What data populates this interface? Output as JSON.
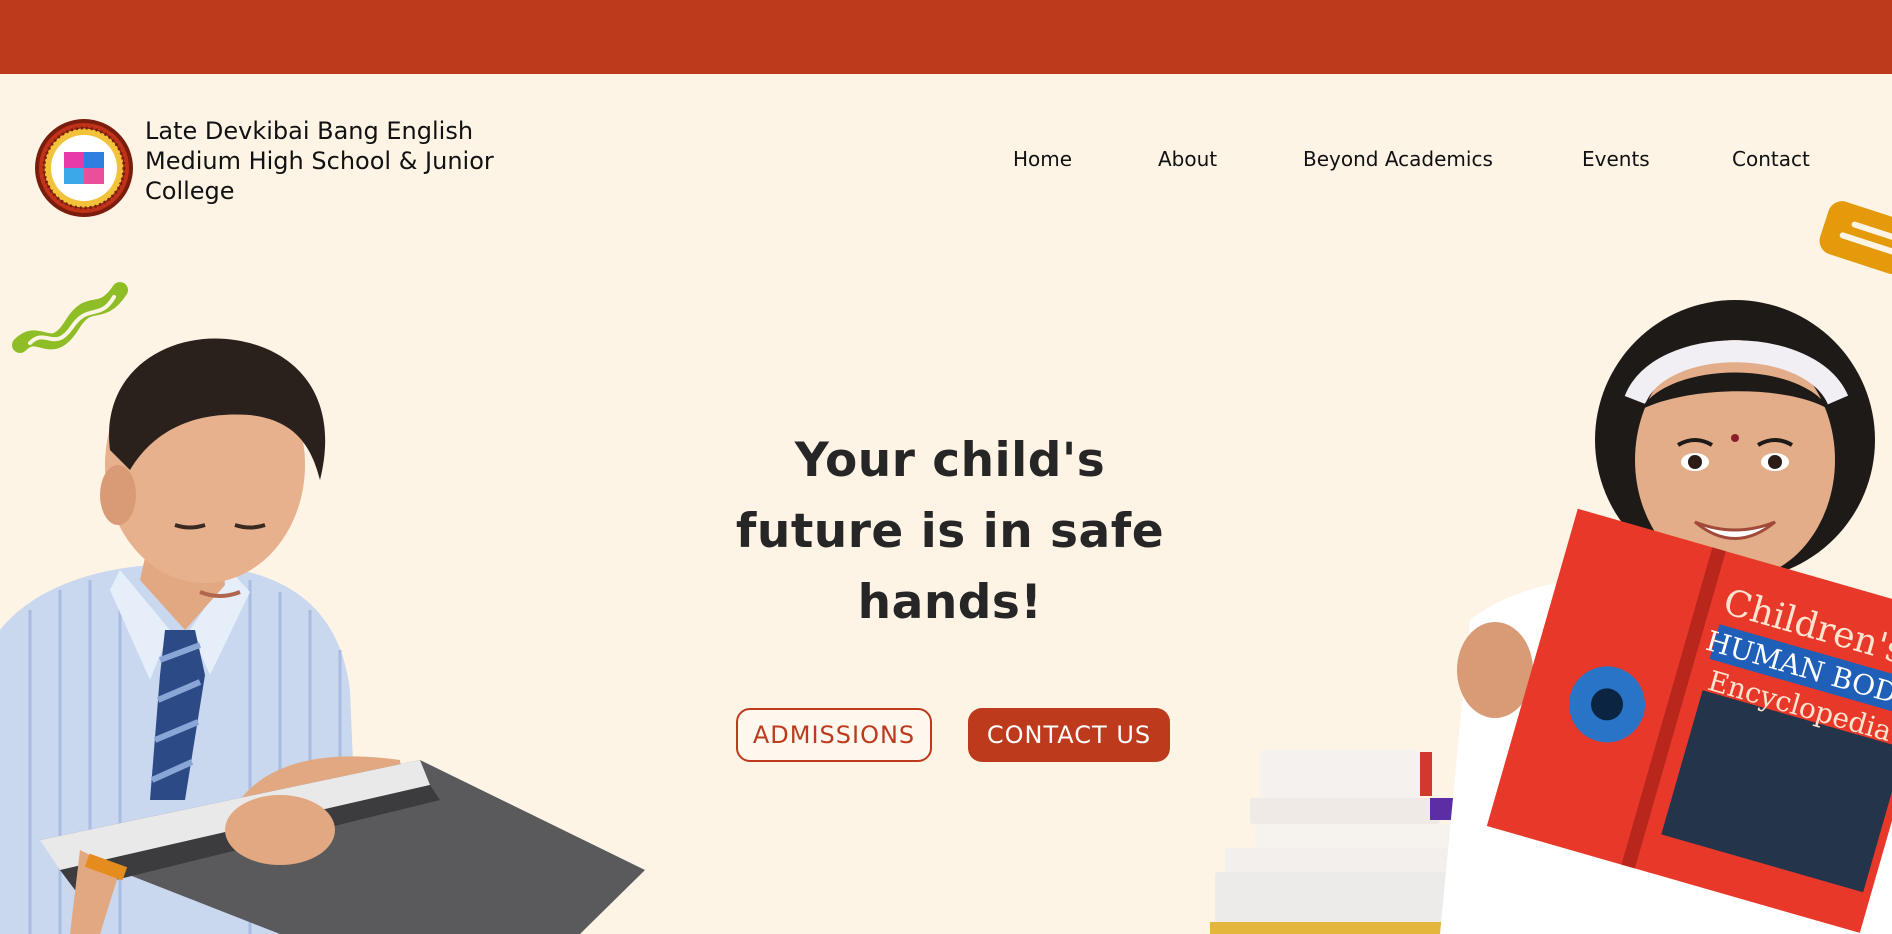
{
  "header": {
    "school_name": "Late Devkibai Bang English Medium High School & Junior College",
    "logo_alt": "school-logo"
  },
  "nav": {
    "items": [
      {
        "label": "Home"
      },
      {
        "label": "About"
      },
      {
        "label": "Beyond Academics"
      },
      {
        "label": "Events"
      },
      {
        "label": "Contact"
      }
    ]
  },
  "hero": {
    "title_line1": "Your child's",
    "title_line2": "future is in safe",
    "title_line3": "hands!",
    "admissions_label": "ADMISSIONS",
    "contact_label": "CONTACT US"
  },
  "book": {
    "title_line1": "Children's",
    "title_line2": "HUMAN BODY",
    "title_line3": "Encyclopedia"
  },
  "colors": {
    "brand": "#bd3a1c",
    "background": "#fdf4e6",
    "accent_green": "#8fbd25",
    "accent_orange": "#e59a0c"
  }
}
